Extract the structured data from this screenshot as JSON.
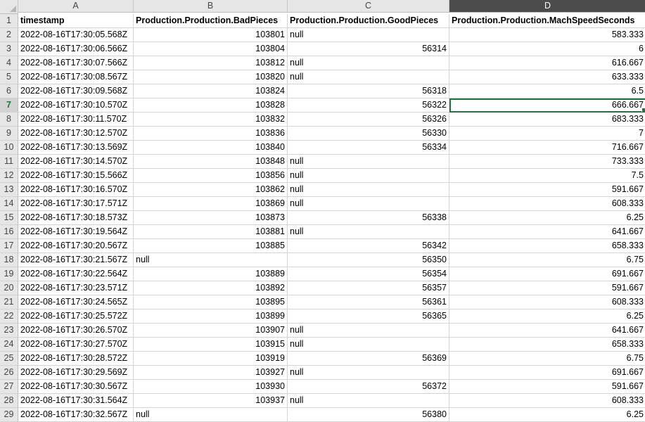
{
  "columns": [
    "A",
    "B",
    "C",
    "D"
  ],
  "selected_column": "D",
  "selected_row": 7,
  "header": [
    "timestamp",
    "Production.Production.BadPieces",
    "Production.Production.GoodPieces",
    "Production.Production.MachSpeedSeconds"
  ],
  "rows": [
    {
      "n": "2",
      "a": "2022-08-16T17:30:05.568Z",
      "b": "103801",
      "c": "null",
      "d": "583.333"
    },
    {
      "n": "3",
      "a": "2022-08-16T17:30:06.566Z",
      "b": "103804",
      "c": "56314",
      "d": "6"
    },
    {
      "n": "4",
      "a": "2022-08-16T17:30:07.566Z",
      "b": "103812",
      "c": "null",
      "d": "616.667"
    },
    {
      "n": "5",
      "a": "2022-08-16T17:30:08.567Z",
      "b": "103820",
      "c": "null",
      "d": "633.333"
    },
    {
      "n": "6",
      "a": "2022-08-16T17:30:09.568Z",
      "b": "103824",
      "c": "56318",
      "d": "6.5"
    },
    {
      "n": "7",
      "a": "2022-08-16T17:30:10.570Z",
      "b": "103828",
      "c": "56322",
      "d": "666.667"
    },
    {
      "n": "8",
      "a": "2022-08-16T17:30:11.570Z",
      "b": "103832",
      "c": "56326",
      "d": "683.333"
    },
    {
      "n": "9",
      "a": "2022-08-16T17:30:12.570Z",
      "b": "103836",
      "c": "56330",
      "d": "7"
    },
    {
      "n": "10",
      "a": "2022-08-16T17:30:13.569Z",
      "b": "103840",
      "c": "56334",
      "d": "716.667"
    },
    {
      "n": "11",
      "a": "2022-08-16T17:30:14.570Z",
      "b": "103848",
      "c": "null",
      "d": "733.333"
    },
    {
      "n": "12",
      "a": "2022-08-16T17:30:15.566Z",
      "b": "103856",
      "c": "null",
      "d": "7.5"
    },
    {
      "n": "13",
      "a": "2022-08-16T17:30:16.570Z",
      "b": "103862",
      "c": "null",
      "d": "591.667"
    },
    {
      "n": "14",
      "a": "2022-08-16T17:30:17.571Z",
      "b": "103869",
      "c": "null",
      "d": "608.333"
    },
    {
      "n": "15",
      "a": "2022-08-16T17:30:18.573Z",
      "b": "103873",
      "c": "56338",
      "d": "6.25"
    },
    {
      "n": "16",
      "a": "2022-08-16T17:30:19.564Z",
      "b": "103881",
      "c": "null",
      "d": "641.667"
    },
    {
      "n": "17",
      "a": "2022-08-16T17:30:20.567Z",
      "b": "103885",
      "c": "56342",
      "d": "658.333"
    },
    {
      "n": "18",
      "a": "2022-08-16T17:30:21.567Z",
      "b": "null",
      "c": "56350",
      "d": "6.75"
    },
    {
      "n": "19",
      "a": "2022-08-16T17:30:22.564Z",
      "b": "103889",
      "c": "56354",
      "d": "691.667"
    },
    {
      "n": "20",
      "a": "2022-08-16T17:30:23.571Z",
      "b": "103892",
      "c": "56357",
      "d": "591.667"
    },
    {
      "n": "21",
      "a": "2022-08-16T17:30:24.565Z",
      "b": "103895",
      "c": "56361",
      "d": "608.333"
    },
    {
      "n": "22",
      "a": "2022-08-16T17:30:25.572Z",
      "b": "103899",
      "c": "56365",
      "d": "6.25"
    },
    {
      "n": "23",
      "a": "2022-08-16T17:30:26.570Z",
      "b": "103907",
      "c": "null",
      "d": "641.667"
    },
    {
      "n": "24",
      "a": "2022-08-16T17:30:27.570Z",
      "b": "103915",
      "c": "null",
      "d": "658.333"
    },
    {
      "n": "25",
      "a": "2022-08-16T17:30:28.572Z",
      "b": "103919",
      "c": "56369",
      "d": "6.75"
    },
    {
      "n": "26",
      "a": "2022-08-16T17:30:29.569Z",
      "b": "103927",
      "c": "null",
      "d": "691.667"
    },
    {
      "n": "27",
      "a": "2022-08-16T17:30:30.567Z",
      "b": "103930",
      "c": "56372",
      "d": "591.667"
    },
    {
      "n": "28",
      "a": "2022-08-16T17:30:31.564Z",
      "b": "103937",
      "c": "null",
      "d": "608.333"
    },
    {
      "n": "29",
      "a": "2022-08-16T17:30:32.567Z",
      "b": "null",
      "c": "56380",
      "d": "6.25"
    }
  ],
  "colors": {
    "accent": "#217346",
    "header_bg": "#e6e6e6",
    "selected_col_bg": "#4b4b4b",
    "gridline": "#d4d4d4"
  }
}
